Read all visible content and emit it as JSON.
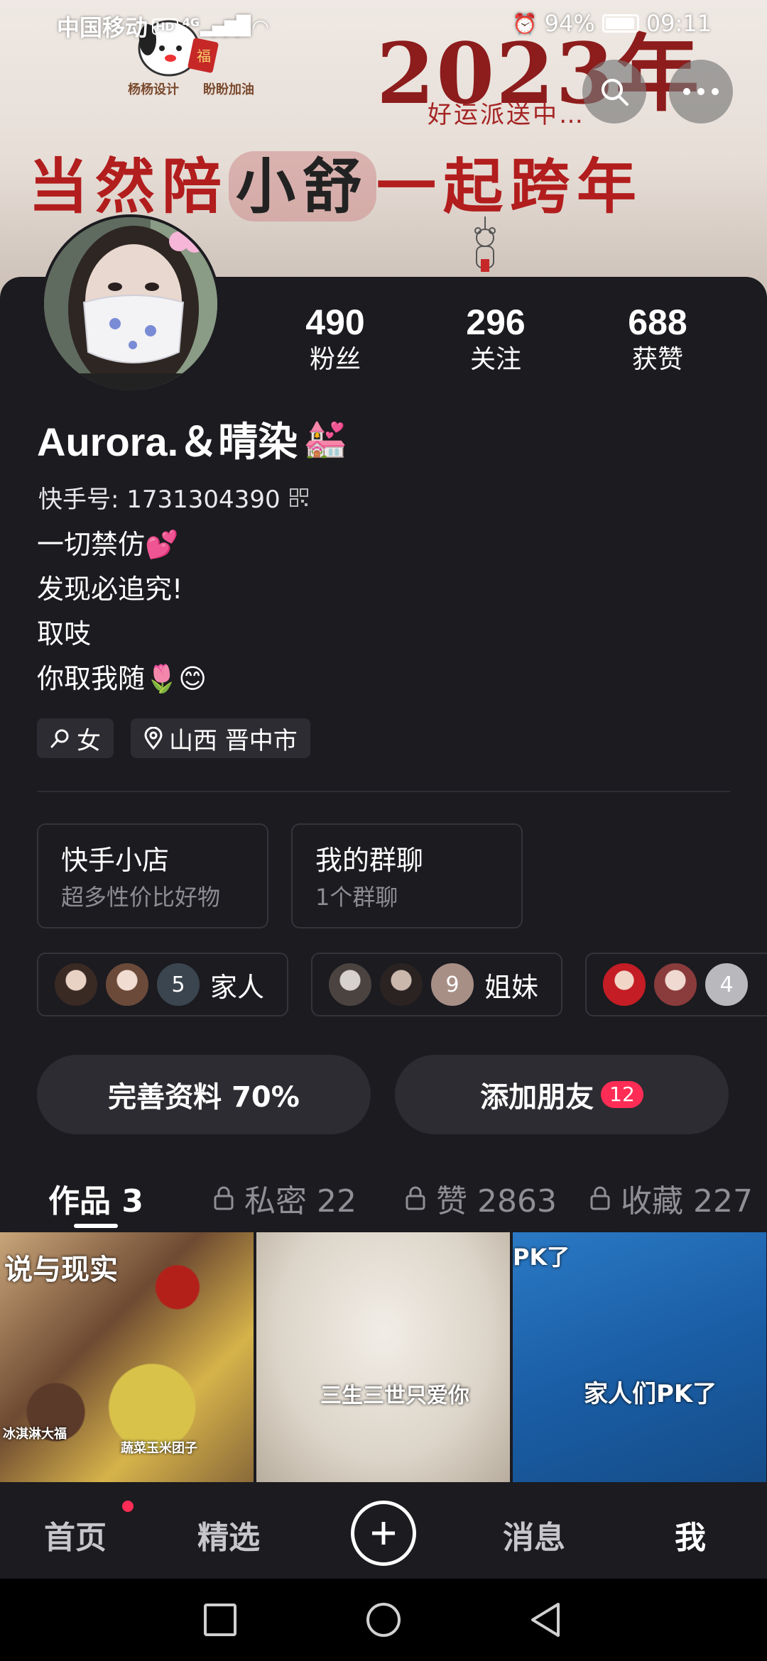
{
  "status_bar": {
    "carrier": "中国移动",
    "hd": "HD",
    "network": "4G",
    "battery": "94%",
    "time": "09:11"
  },
  "banner": {
    "year_text": "2023年",
    "sub_text": "好运派送中…",
    "slogan_pre": "当然陪",
    "slogan_highlight": "小舒",
    "slogan_post": "一起跨年",
    "mascot_tag_1": "杨杨设计",
    "mascot_tag_2": "盼盼加油"
  },
  "profile": {
    "stats": [
      {
        "value": "490",
        "label": "粉丝"
      },
      {
        "value": "296",
        "label": "关注"
      },
      {
        "value": "688",
        "label": "获赞"
      }
    ],
    "name": "Aurora.＆晴染",
    "name_emoji": "💒",
    "kuaishou_id": "快手号: 1731304390",
    "bio_lines": [
      "一切禁仿💕",
      "发现必追究!",
      "取吱",
      "你取我随🌷😊"
    ],
    "tags": [
      {
        "icon": "gender-icon",
        "text": "女"
      },
      {
        "icon": "location-icon",
        "text": "山西 晋中市"
      }
    ]
  },
  "features": [
    {
      "title": "快手小店",
      "subtitle": "超多性价比好物"
    },
    {
      "title": "我的群聊",
      "subtitle": "1个群聊"
    }
  ],
  "groups": [
    {
      "name": "家人",
      "count": "5"
    },
    {
      "name": "姐妹",
      "count": "9"
    },
    {
      "name": "",
      "count": "4"
    }
  ],
  "actions": {
    "complete_profile": "完善资料 70%",
    "add_friend": "添加朋友",
    "add_friend_badge": "12"
  },
  "tabs": [
    {
      "label": "作品 3",
      "locked": false
    },
    {
      "label": "私密 22",
      "locked": true
    },
    {
      "label": "赞 2863",
      "locked": true
    },
    {
      "label": "收藏 227",
      "locked": true
    }
  ],
  "videos": [
    {
      "caption": "说与现实",
      "sub": "冰淇淋大福",
      "sub2": "蔬菜玉米团子"
    },
    {
      "caption": "三生三世只爱你"
    },
    {
      "caption": "家人们PK了",
      "corner": "PK了"
    }
  ],
  "bottom_nav": {
    "home": "首页",
    "featured": "精选",
    "messages": "消息",
    "me": "我"
  }
}
